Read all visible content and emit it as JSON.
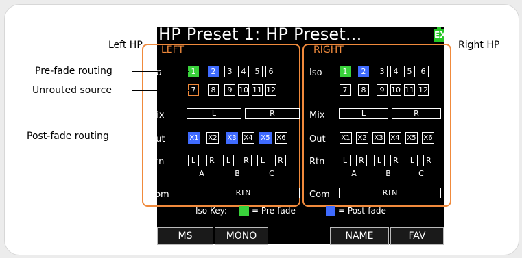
{
  "screen": {
    "title": "HP Preset 1: HP Preset...",
    "battery_label": "EX"
  },
  "left": {
    "header": "LEFT"
  },
  "right": {
    "header": "RIGHT"
  },
  "rows": {
    "iso": "Iso",
    "mix": "Mix",
    "out": "Out",
    "rtn": "Rtn",
    "com": "Com"
  },
  "iso_row1": [
    "1",
    "2",
    "3",
    "4",
    "5",
    "6"
  ],
  "iso_row2": [
    "7",
    "8",
    "9",
    "10",
    "11",
    "12"
  ],
  "mix": [
    "L",
    "R"
  ],
  "out": [
    "X1",
    "X2",
    "X3",
    "X4",
    "X5",
    "X6"
  ],
  "rtn": [
    "L",
    "R",
    "L",
    "R",
    "L",
    "R"
  ],
  "rtn_groups": [
    "A",
    "B",
    "C"
  ],
  "com": "RTN",
  "iso_key": {
    "label": "Iso Key:",
    "pre": "= Pre-fade",
    "post": "= Post-fade"
  },
  "softkeys": {
    "ms": "MS",
    "mono": "MONO",
    "name": "NAME",
    "fav": "FAV"
  },
  "callouts": {
    "left_hp": "Left HP",
    "right_hp": "Right HP",
    "pre_fade": "Pre-fade routing",
    "unrouted": "Unrouted source",
    "post_fade": "Post-fade routing"
  },
  "colors": {
    "accent": "#f08a3c",
    "pre_fade": "#39d23b",
    "post_fade": "#3f6bff"
  }
}
